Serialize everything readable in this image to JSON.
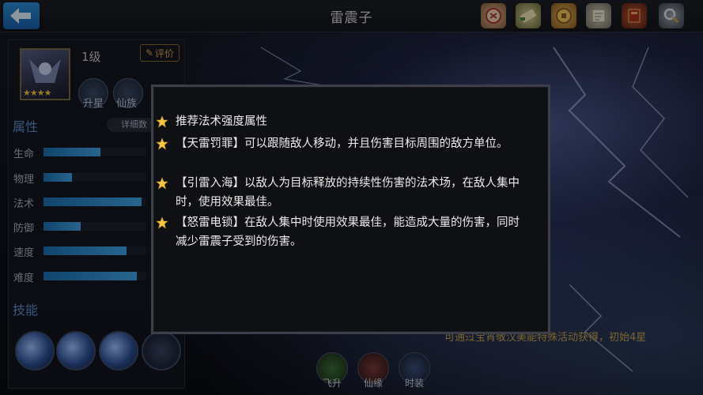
{
  "header": {
    "title": "雷震子"
  },
  "top_icons": [
    "scroll-seal-icon",
    "scroll-icon",
    "coin-icon",
    "map-icon",
    "book-icon",
    "magnifier-icon"
  ],
  "hero": {
    "level": "1级",
    "rate_label": "评价",
    "stars": 4,
    "buttons": [
      {
        "label": "升星"
      },
      {
        "label": "仙族"
      }
    ]
  },
  "attributes": {
    "title": "属性",
    "detail_label": "详细数",
    "stats": [
      {
        "label": "生命",
        "value": 0.55
      },
      {
        "label": "物理",
        "value": 0.28
      },
      {
        "label": "法术",
        "value": 0.95
      },
      {
        "label": "防御",
        "value": 0.36
      },
      {
        "label": "速度",
        "value": 0.81
      },
      {
        "label": "难度",
        "value": 0.91
      }
    ]
  },
  "skills": {
    "title": "技能"
  },
  "bottom": {
    "hint": "可通过宝宵敬汉美能特殊活动获得，初始4星",
    "buttons": [
      {
        "label": "飞升"
      },
      {
        "label": "仙缘"
      },
      {
        "label": "时装"
      }
    ]
  },
  "dialog": {
    "tips": [
      "推荐法术强度属性",
      "【天雷罚罪】可以跟随敌人移动，并且伤害目标周围的敌方单位。",
      "【引雷入海】以敌人为目标释放的持续性伤害的法术场，在敌人集中时，使用效果最佳。",
      "【怒雷电锁】在敌人集中时使用效果最佳，能造成大量的伤害，同时减少雷震子受到的伤害。"
    ]
  },
  "colors": {
    "accent": "#3fa3e6",
    "gold": "#f6c542",
    "section": "#5f8fcf"
  }
}
